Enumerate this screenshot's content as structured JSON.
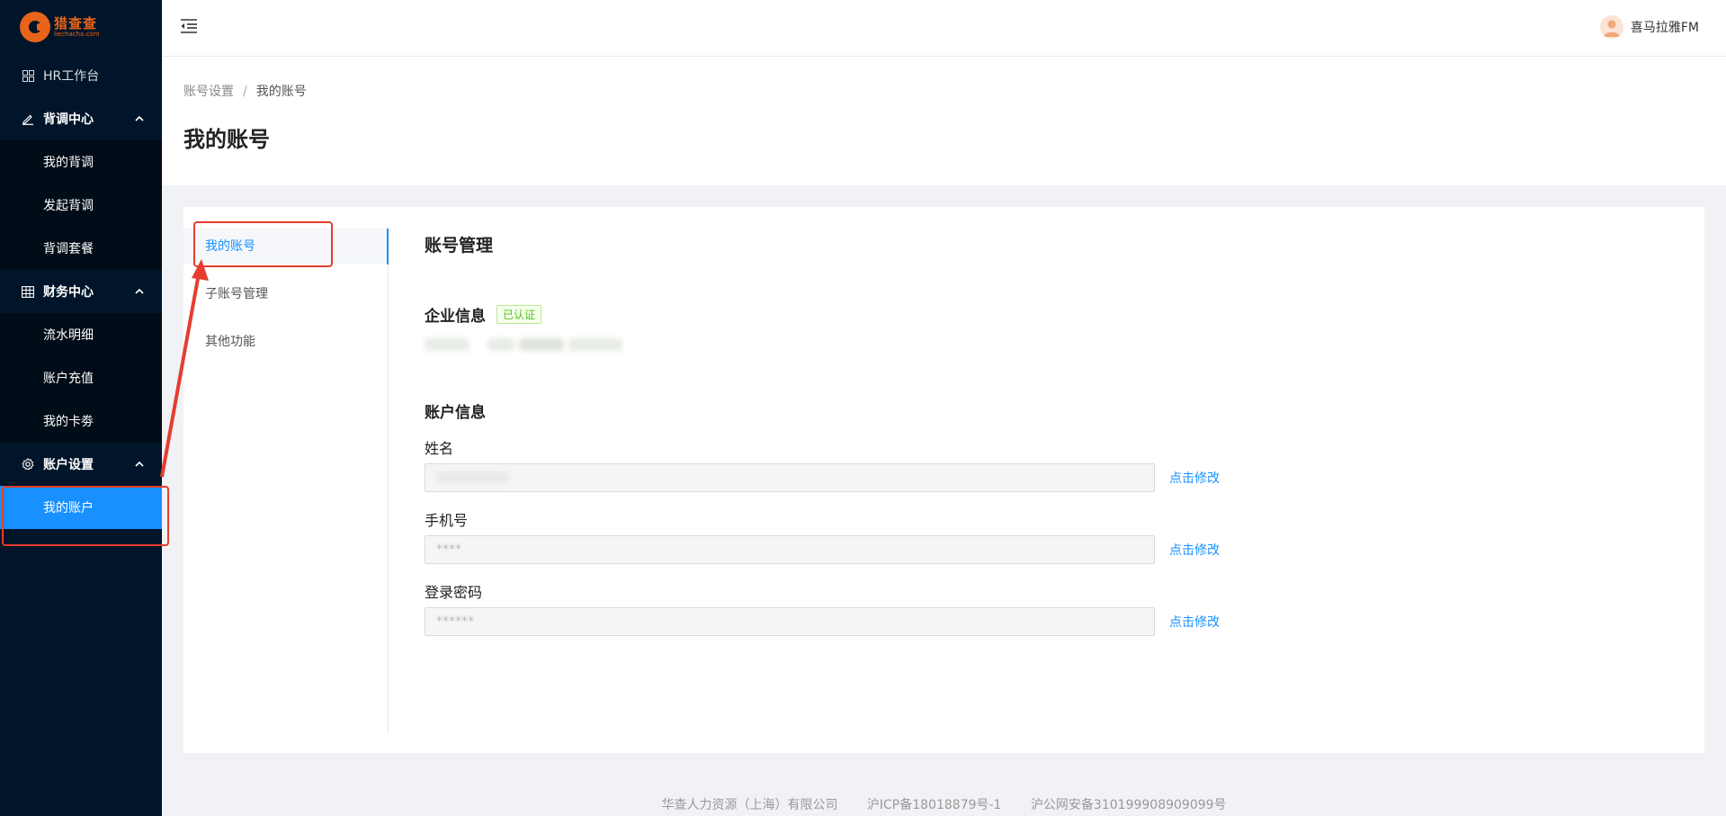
{
  "logo": {
    "cn": "猎查查",
    "en": "liechacha.com"
  },
  "sidebar": {
    "workspace": {
      "label": "HR工作台",
      "icon": "dashboard-icon"
    },
    "groups": [
      {
        "label": "背调中心",
        "icon": "edit-icon",
        "items": [
          "我的背调",
          "发起背调",
          "背调套餐"
        ]
      },
      {
        "label": "财务中心",
        "icon": "table-icon",
        "items": [
          "流水明细",
          "账户充值",
          "我的卡劵"
        ]
      },
      {
        "label": "账户设置",
        "icon": "gear-icon",
        "items": [
          "我的账户"
        ]
      }
    ],
    "active_item": "我的账户",
    "bg_color": "#001529",
    "active_color": "#1890ff"
  },
  "header": {
    "user_name": "喜马拉雅FM",
    "fold_icon": "menu-fold-icon"
  },
  "breadcrumb": {
    "parent": "账号设置",
    "separator": "/",
    "current": "我的账号"
  },
  "page_title": "我的账号",
  "tabs": [
    {
      "label": "我的账号",
      "active": true
    },
    {
      "label": "子账号管理",
      "active": false
    },
    {
      "label": "其他功能",
      "active": false
    }
  ],
  "account": {
    "section_title": "账号管理",
    "company": {
      "heading": "企业信息",
      "badge": "已认证"
    },
    "account_info": {
      "heading": "账户信息",
      "fields": [
        {
          "label": "姓名",
          "value": "",
          "edit": "点击修改"
        },
        {
          "label": "手机号",
          "value": "****",
          "edit": "点击修改"
        },
        {
          "label": "登录密码",
          "value": "******",
          "edit": "点击修改"
        }
      ]
    }
  },
  "footer": {
    "company": "华查人力资源（上海）有限公司",
    "icp": "沪ICP备18018879号-1",
    "police": "沪公网安备310199908909099号"
  },
  "annotation_color": "#e53d2f"
}
